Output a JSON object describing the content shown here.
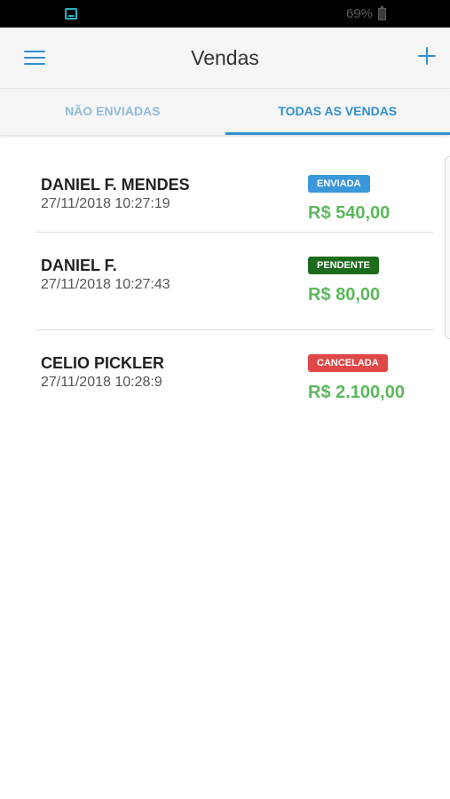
{
  "status_bar": {
    "battery": "69%",
    "app_icon": "cast-icon"
  },
  "app_bar": {
    "title": "Vendas",
    "menu_icon": "hamburger-menu-icon",
    "add_icon": "plus-icon"
  },
  "tabs": [
    {
      "label": "NÃO ENVIADAS",
      "active": false
    },
    {
      "label": "TODAS AS VENDAS",
      "active": true
    }
  ],
  "colors": {
    "accent": "#2f8fd0",
    "value_green": "#5cb85c",
    "badge_enviada": "#3a97d9",
    "badge_pendente": "#1c6b1c",
    "badge_cancelada": "#e04848"
  },
  "sales": [
    {
      "name": "DANIEL F. MENDES",
      "date": "27/11/2018 10:27:19",
      "status": "ENVIADA",
      "value": "R$ 540,00"
    },
    {
      "name": "DANIEL F.",
      "date": "27/11/2018 10:27:43",
      "status": "PENDENTE",
      "value": "R$ 80,00"
    },
    {
      "name": "CELIO PICKLER",
      "date": "27/11/2018 10:28:9",
      "status": "CANCELADA",
      "value": "R$ 2.100,00"
    }
  ]
}
